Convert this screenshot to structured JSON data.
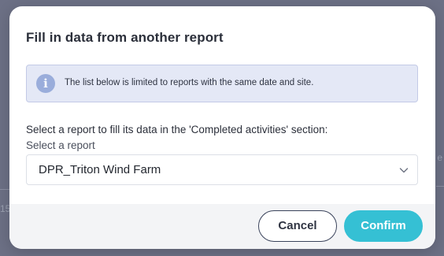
{
  "modal": {
    "title": "Fill in data from another report",
    "info": {
      "icon": "info-icon",
      "icon_glyph": "i",
      "text": "The list below is limited to reports with the same date and site."
    },
    "select_prompt": "Select a report to fill its data in the 'Completed activities' section:",
    "field_label": "Select a report",
    "selected_report": "DPR_Triton Wind Farm",
    "dropdown_icon": "chevron-down-icon",
    "cancel_label": "Cancel",
    "confirm_label": "Confirm"
  },
  "background": {
    "partial_text_left": "15",
    "partial_text_right": "e"
  },
  "colors": {
    "overlay": "#6c7085",
    "info_background": "#e4e8f6",
    "info_icon": "#9aaddb",
    "confirm": "#35c0d4",
    "cancel_border": "#39425a",
    "footer": "#f3f4f6"
  }
}
